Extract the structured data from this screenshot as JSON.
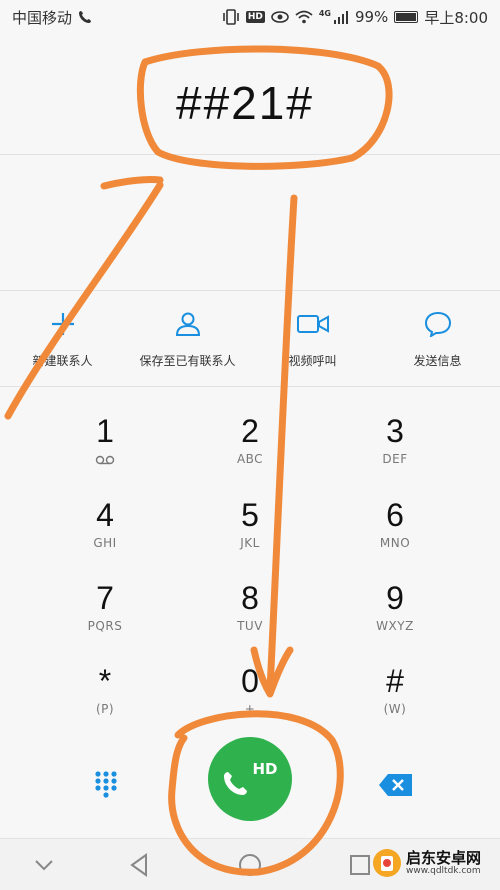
{
  "status_bar": {
    "carrier": "中国移动",
    "network_badge": "4G",
    "battery_percent": "99%",
    "time": "早上8:00",
    "hd_badge": "HD"
  },
  "dialer": {
    "number": "##21#"
  },
  "actions": [
    {
      "label": "新建联系人",
      "icon": "plus-icon"
    },
    {
      "label": "保存至已有联系人",
      "icon": "person-icon"
    },
    {
      "label": "视频呼叫",
      "icon": "video-icon"
    },
    {
      "label": "发送信息",
      "icon": "message-icon"
    }
  ],
  "keypad": [
    {
      "digit": "1",
      "sub": ""
    },
    {
      "digit": "2",
      "sub": "ABC"
    },
    {
      "digit": "3",
      "sub": "DEF"
    },
    {
      "digit": "4",
      "sub": "GHI"
    },
    {
      "digit": "5",
      "sub": "JKL"
    },
    {
      "digit": "6",
      "sub": "MNO"
    },
    {
      "digit": "7",
      "sub": "PQRS"
    },
    {
      "digit": "8",
      "sub": "TUV"
    },
    {
      "digit": "9",
      "sub": "WXYZ"
    },
    {
      "digit": "*",
      "sub": "(P)"
    },
    {
      "digit": "0",
      "sub": "+"
    },
    {
      "digit": "#",
      "sub": "(W)"
    }
  ],
  "call_button": {
    "label": "HD"
  },
  "watermark": {
    "title": "启东安卓网",
    "url": "www.qdltdk.com"
  },
  "colors": {
    "accent": "#1a8fe0",
    "call_green": "#2fb24d",
    "annotation": "#f08a3a"
  }
}
